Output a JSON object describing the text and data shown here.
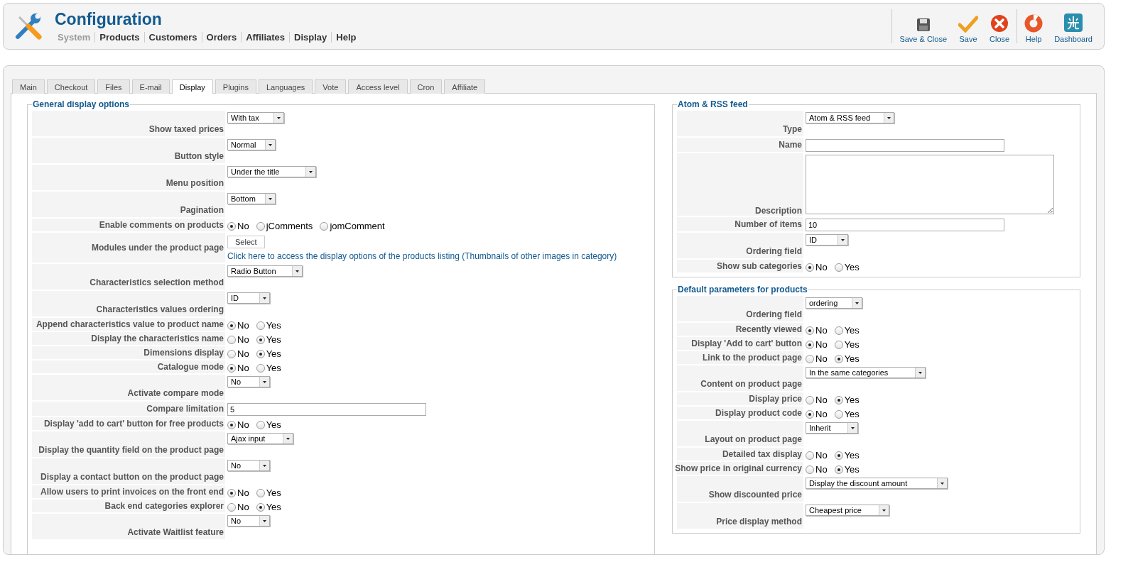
{
  "header": {
    "title": "Configuration",
    "nav": [
      {
        "label": "System",
        "disabled": true
      },
      {
        "label": "Products",
        "disabled": false
      },
      {
        "label": "Customers",
        "disabled": false
      },
      {
        "label": "Orders",
        "disabled": false
      },
      {
        "label": "Affiliates",
        "disabled": false
      },
      {
        "label": "Display",
        "disabled": false
      },
      {
        "label": "Help",
        "disabled": false
      }
    ]
  },
  "toolbar": {
    "groups": [
      {
        "buttons": [
          {
            "label": "Save & Close",
            "kind": "save_close"
          },
          {
            "label": "Save",
            "kind": "save"
          },
          {
            "label": "Close",
            "kind": "close"
          }
        ]
      },
      {
        "buttons": [
          {
            "label": "Help",
            "kind": "help"
          },
          {
            "label": "Dashboard",
            "kind": "dashboard"
          }
        ]
      }
    ]
  },
  "tabs": [
    {
      "label": "Main",
      "selected": false
    },
    {
      "label": "Checkout",
      "selected": false
    },
    {
      "label": "Files",
      "selected": false
    },
    {
      "label": "E-mail",
      "selected": false
    },
    {
      "label": "Display",
      "selected": true
    },
    {
      "label": "Plugins",
      "selected": false
    },
    {
      "label": "Languages",
      "selected": false
    },
    {
      "label": "Vote",
      "selected": false
    },
    {
      "label": "Access level",
      "selected": false
    },
    {
      "label": "Cron",
      "selected": false
    },
    {
      "label": "Affiliate",
      "selected": false
    }
  ],
  "left": {
    "legend": "General display options",
    "rows": [
      {
        "label": "Show taxed prices",
        "kind": "select",
        "value": "With tax"
      },
      {
        "label": "Button style",
        "kind": "select",
        "value": "Normal"
      },
      {
        "label": "Menu position",
        "kind": "select",
        "value": "Under the title"
      },
      {
        "label": "Pagination",
        "kind": "select",
        "value": "Bottom"
      },
      {
        "label": "Enable comments on products",
        "kind": "radio",
        "options": [
          {
            "label": "No",
            "selected": true
          },
          {
            "label": "jComments",
            "selected": false
          },
          {
            "label": "jomComment",
            "selected": false
          }
        ]
      },
      {
        "label": "Modules under the product page",
        "kind": "modules",
        "button": "Select",
        "link": "Click here to access the display options of the products listing (Thumbnails of other images in category)"
      },
      {
        "label": "Characteristics selection method",
        "kind": "select",
        "value": "Radio Button"
      },
      {
        "label": "Characteristics values ordering",
        "kind": "select",
        "value": "ID"
      },
      {
        "label": "Append characteristics value to product name",
        "kind": "radio",
        "options": [
          {
            "label": "No",
            "selected": true
          },
          {
            "label": "Yes",
            "selected": false
          }
        ]
      },
      {
        "label": "Display the characteristics name",
        "kind": "radio",
        "options": [
          {
            "label": "No",
            "selected": false
          },
          {
            "label": "Yes",
            "selected": true
          }
        ]
      },
      {
        "label": "Dimensions display",
        "kind": "radio",
        "options": [
          {
            "label": "No",
            "selected": false
          },
          {
            "label": "Yes",
            "selected": true
          }
        ]
      },
      {
        "label": "Catalogue mode",
        "kind": "radio",
        "options": [
          {
            "label": "No",
            "selected": true
          },
          {
            "label": "Yes",
            "selected": false
          }
        ]
      },
      {
        "label": "Activate compare mode",
        "kind": "select",
        "value": "No"
      },
      {
        "label": "Compare limitation",
        "kind": "text",
        "value": "5"
      },
      {
        "label": "Display 'add to cart' button for free products",
        "kind": "radio",
        "options": [
          {
            "label": "No",
            "selected": true
          },
          {
            "label": "Yes",
            "selected": false
          }
        ]
      },
      {
        "label": "Display the quantity field on the product page",
        "kind": "select",
        "value": "Ajax input"
      },
      {
        "label": "Display a contact button on the product page",
        "kind": "select",
        "value": "No"
      },
      {
        "label": "Allow users to print invoices on the front end",
        "kind": "radio",
        "options": [
          {
            "label": "No",
            "selected": true
          },
          {
            "label": "Yes",
            "selected": false
          }
        ]
      },
      {
        "label": "Back end categories explorer",
        "kind": "radio",
        "options": [
          {
            "label": "No",
            "selected": false
          },
          {
            "label": "Yes",
            "selected": true
          }
        ]
      },
      {
        "label": "Activate Waitlist feature",
        "kind": "select",
        "value": "No"
      }
    ]
  },
  "right": [
    {
      "legend": "Atom & RSS feed",
      "rows": [
        {
          "label": "Type",
          "kind": "select",
          "value": "Atom & RSS feed"
        },
        {
          "label": "Name",
          "kind": "text"
        },
        {
          "label": "Description",
          "kind": "textarea"
        },
        {
          "label": "Number of items",
          "kind": "text",
          "value": "10"
        },
        {
          "label": "Ordering field",
          "kind": "select",
          "value": "ID"
        },
        {
          "label": "Show sub categories",
          "kind": "radio",
          "options": [
            {
              "label": "No",
              "selected": true
            },
            {
              "label": "Yes",
              "selected": false
            }
          ]
        }
      ]
    },
    {
      "legend": "Default parameters for products",
      "rows": [
        {
          "label": "Ordering field",
          "kind": "select",
          "value": "ordering"
        },
        {
          "label": "Recently viewed",
          "kind": "radio",
          "options": [
            {
              "label": "No",
              "selected": true
            },
            {
              "label": "Yes",
              "selected": false
            }
          ]
        },
        {
          "label": "Display 'Add to cart' button",
          "kind": "radio",
          "options": [
            {
              "label": "No",
              "selected": true
            },
            {
              "label": "Yes",
              "selected": false
            }
          ]
        },
        {
          "label": "Link to the product page",
          "kind": "radio",
          "options": [
            {
              "label": "No",
              "selected": false
            },
            {
              "label": "Yes",
              "selected": true
            }
          ]
        },
        {
          "label": "Content on product page",
          "kind": "select",
          "value": "In the same categories"
        },
        {
          "label": "Display price",
          "kind": "radio",
          "options": [
            {
              "label": "No",
              "selected": false
            },
            {
              "label": "Yes",
              "selected": true
            }
          ]
        },
        {
          "label": "Display product code",
          "kind": "radio",
          "options": [
            {
              "label": "No",
              "selected": true
            },
            {
              "label": "Yes",
              "selected": false
            }
          ]
        },
        {
          "label": "Layout on product page",
          "kind": "select",
          "value": "Inherit"
        },
        {
          "label": "Detailed tax display",
          "kind": "radio",
          "options": [
            {
              "label": "No",
              "selected": false
            },
            {
              "label": "Yes",
              "selected": true
            }
          ]
        },
        {
          "label": "Show price in original currency",
          "kind": "radio",
          "options": [
            {
              "label": "No",
              "selected": false
            },
            {
              "label": "Yes",
              "selected": true
            }
          ]
        },
        {
          "label": "Show discounted price",
          "kind": "select",
          "value": "Display the discount amount"
        },
        {
          "label": "Price display method",
          "kind": "select",
          "value": "Cheapest price"
        }
      ]
    }
  ]
}
